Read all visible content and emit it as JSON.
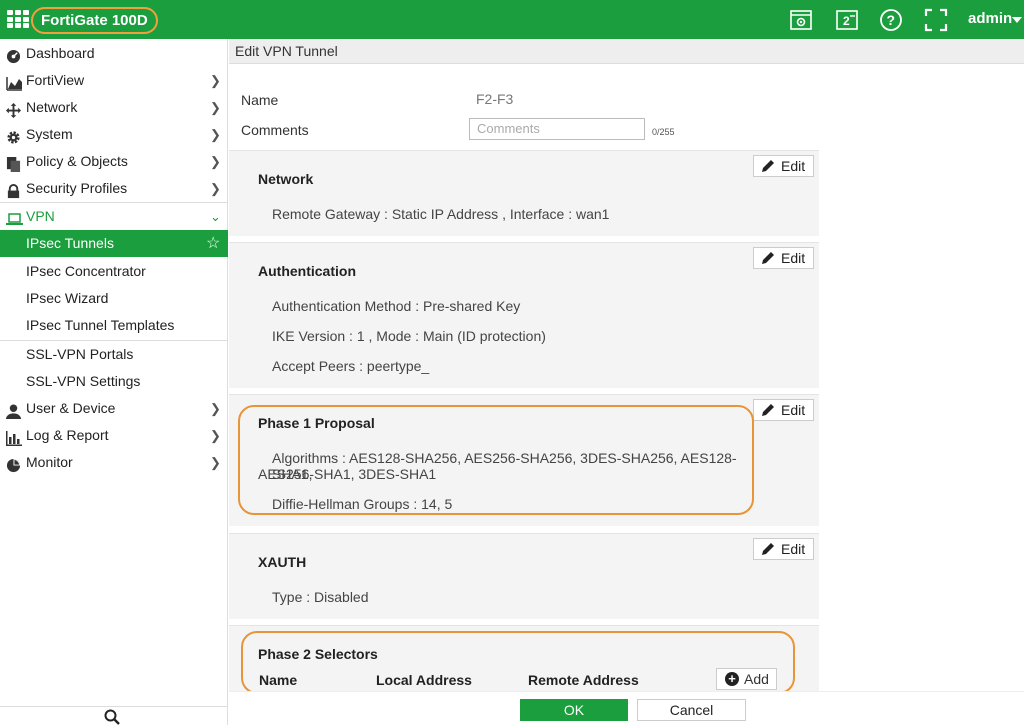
{
  "topbar": {
    "brand": "FortiGate 100D",
    "user": "admin",
    "icons": [
      "cli-console-icon",
      "fullscreen-icon",
      "help-icon",
      "expand-icon"
    ]
  },
  "sidebar": {
    "items": [
      {
        "label": "Dashboard",
        "icon": "dashboard-icon"
      },
      {
        "label": "FortiView",
        "icon": "chart-icon"
      },
      {
        "label": "Network",
        "icon": "network-arrows-icon"
      },
      {
        "label": "System",
        "icon": "gear-icon"
      },
      {
        "label": "Policy & Objects",
        "icon": "document-icon"
      },
      {
        "label": "Security Profiles",
        "icon": "lock-icon"
      },
      {
        "label": "VPN",
        "icon": "laptop-icon"
      },
      {
        "label": "IPsec Tunnels"
      },
      {
        "label": "IPsec Concentrator"
      },
      {
        "label": "IPsec Wizard"
      },
      {
        "label": "IPsec Tunnel Templates"
      },
      {
        "label": "SSL-VPN Portals"
      },
      {
        "label": "SSL-VPN Settings"
      },
      {
        "label": "User & Device",
        "icon": "user-icon"
      },
      {
        "label": "Log & Report",
        "icon": "bar-chart-icon"
      },
      {
        "label": "Monitor",
        "icon": "pie-icon"
      }
    ]
  },
  "main": {
    "title": "Edit VPN Tunnel",
    "name_label": "Name",
    "name_value": "F2-F3",
    "comments_label": "Comments",
    "comments_placeholder": "Comments",
    "comments_counter": "0/255",
    "edit_label": "Edit",
    "sections": {
      "network": {
        "title": "Network",
        "lines": [
          "Remote Gateway : Static IP Address , Interface : wan1"
        ]
      },
      "auth": {
        "title": "Authentication",
        "lines": [
          "Authentication Method : Pre-shared Key",
          "IKE Version : 1 , Mode : Main (ID protection)",
          "Accept Peers : peertype_"
        ]
      },
      "phase1": {
        "title": "Phase 1 Proposal",
        "algorithms_line1": "Algorithms : AES128-SHA256, AES256-SHA256, 3DES-SHA256, AES128-SHA1,",
        "algorithms_line2": "AES256-SHA1, 3DES-SHA1",
        "dh": "Diffie-Hellman Groups : 14, 5"
      },
      "xauth": {
        "title": "XAUTH",
        "lines": [
          "Type : Disabled"
        ]
      },
      "phase2": {
        "title": "Phase 2 Selectors",
        "columns": [
          "Name",
          "Local Address",
          "Remote Address"
        ],
        "add_label": "Add"
      }
    },
    "ok_label": "OK",
    "cancel_label": "Cancel"
  },
  "colors": {
    "brand_green": "#1b9e3e",
    "highlight_orange": "#e8953a"
  }
}
